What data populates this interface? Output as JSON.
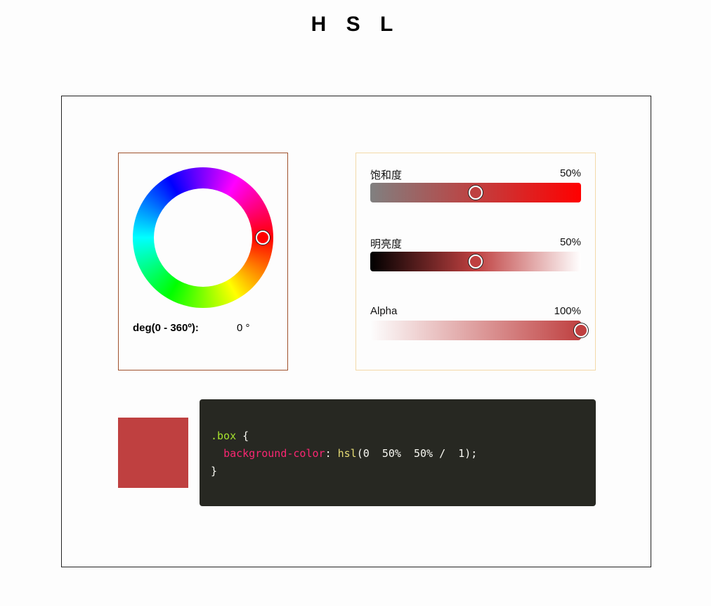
{
  "title": "H S L",
  "hue": {
    "label": "deg(0 - 360º):",
    "value": "0 °"
  },
  "sliders": [
    {
      "label": "饱和度",
      "display": "50%",
      "level": 0.5
    },
    {
      "label": "明亮度",
      "display": "50%",
      "level": 0.5
    },
    {
      "label": "Alpha",
      "display": "100%",
      "level": 1.0
    }
  ],
  "colors": {
    "current": "#bf4040",
    "code_bg": "#272822",
    "hue_panel_border": "#a0522d",
    "slider_panel_border": "#f3d9a8"
  },
  "code": {
    "selector": ".box",
    "open_brace": " {",
    "property": "background-color",
    "colon": ": ",
    "fn_name": "hsl",
    "args": "(0  50%  50% /  1);",
    "close_brace": "}"
  }
}
